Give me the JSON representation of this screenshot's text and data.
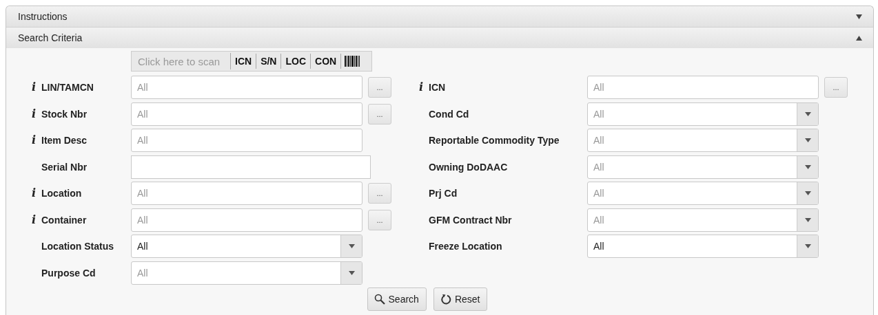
{
  "sections": [
    {
      "title": "Instructions",
      "expanded": false
    },
    {
      "title": "Search Criteria",
      "expanded": true,
      "scan_bar": {
        "placeholder": "Click here to scan",
        "buttons": [
          "ICN",
          "S/N",
          "LOC",
          "CON"
        ]
      },
      "left_fields": [
        {
          "label": "LIN/TAMCN",
          "info": "i",
          "kind": "lookup",
          "placeholder": "All",
          "button": "..."
        },
        {
          "label": "Stock Nbr",
          "info": "i",
          "kind": "lookup",
          "placeholder": "All",
          "button": "..."
        },
        {
          "label": "Item Desc",
          "info": "i",
          "kind": "text",
          "placeholder": "All"
        },
        {
          "label": "Serial Nbr",
          "kind": "plain"
        },
        {
          "label": "Location",
          "info": "i",
          "kind": "lookup",
          "placeholder": "All",
          "button": "..."
        },
        {
          "label": "Container",
          "info": "i",
          "kind": "lookup",
          "placeholder": "All",
          "button": "..."
        },
        {
          "label": "Location Status",
          "kind": "select",
          "value": "All"
        },
        {
          "label": "Purpose Cd",
          "kind": "select",
          "placeholder": "All"
        }
      ],
      "right_fields": [
        {
          "label": "ICN",
          "info": "i",
          "kind": "lookup",
          "placeholder": "All",
          "button": "..."
        },
        {
          "label": "Cond Cd",
          "kind": "select",
          "placeholder": "All"
        },
        {
          "label": "Reportable Commodity Type",
          "kind": "select",
          "placeholder": "All"
        },
        {
          "label": "Owning DoDAAC",
          "kind": "select",
          "placeholder": "All"
        },
        {
          "label": "Prj Cd",
          "kind": "select",
          "placeholder": "All"
        },
        {
          "label": "GFM Contract Nbr",
          "kind": "select",
          "placeholder": "All"
        },
        {
          "label": "Freeze Location",
          "kind": "select",
          "value": "All"
        }
      ],
      "actions": [
        {
          "label": "Search",
          "kind": "search"
        },
        {
          "label": "Reset",
          "kind": "reset"
        }
      ]
    }
  ]
}
